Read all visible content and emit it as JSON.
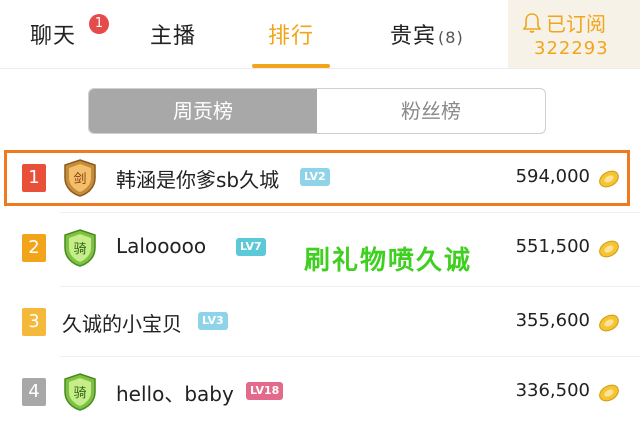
{
  "tabs": {
    "chat": {
      "label": "聊天",
      "badge": "1"
    },
    "host": {
      "label": "主播"
    },
    "ranking": {
      "label": "排行"
    },
    "vip": {
      "label": "贵宾",
      "count": "(8)"
    }
  },
  "subscribe": {
    "label": "已订阅",
    "count": "322293",
    "icon": "bell-icon"
  },
  "segment": {
    "weekly": "周贡榜",
    "fans": "粉丝榜",
    "selected": "weekly"
  },
  "ranking": [
    {
      "rank": "1",
      "name": "韩涵是你爹sb久城",
      "level": "LV2",
      "amount": "594,000",
      "rank_color": "#e8503a",
      "level_color": "#8fd3e8",
      "icon": "sword-shield-icon"
    },
    {
      "rank": "2",
      "name": "Lalooooo",
      "level": "LV7",
      "amount": "551,500",
      "rank_color": "#f2a51a",
      "level_color": "#5cc9d9",
      "icon": "rider-shield-icon"
    },
    {
      "rank": "3",
      "name": "久诚的小宝贝",
      "level": "LV3",
      "amount": "355,600",
      "rank_color": "#f4b83a",
      "level_color": "#8fd3e8",
      "icon": null
    },
    {
      "rank": "4",
      "name": "hello、baby",
      "level": "LV18",
      "amount": "336,500",
      "rank_color": "#a8a8a8",
      "level_color": "#e36a8a",
      "icon": "rider-shield-icon"
    }
  ],
  "overlay_text": "刷礼物喷久诚",
  "colors": {
    "accent": "#f2a51a",
    "highlight_border": "#f07a1f",
    "promo": "#3fcf1f"
  }
}
